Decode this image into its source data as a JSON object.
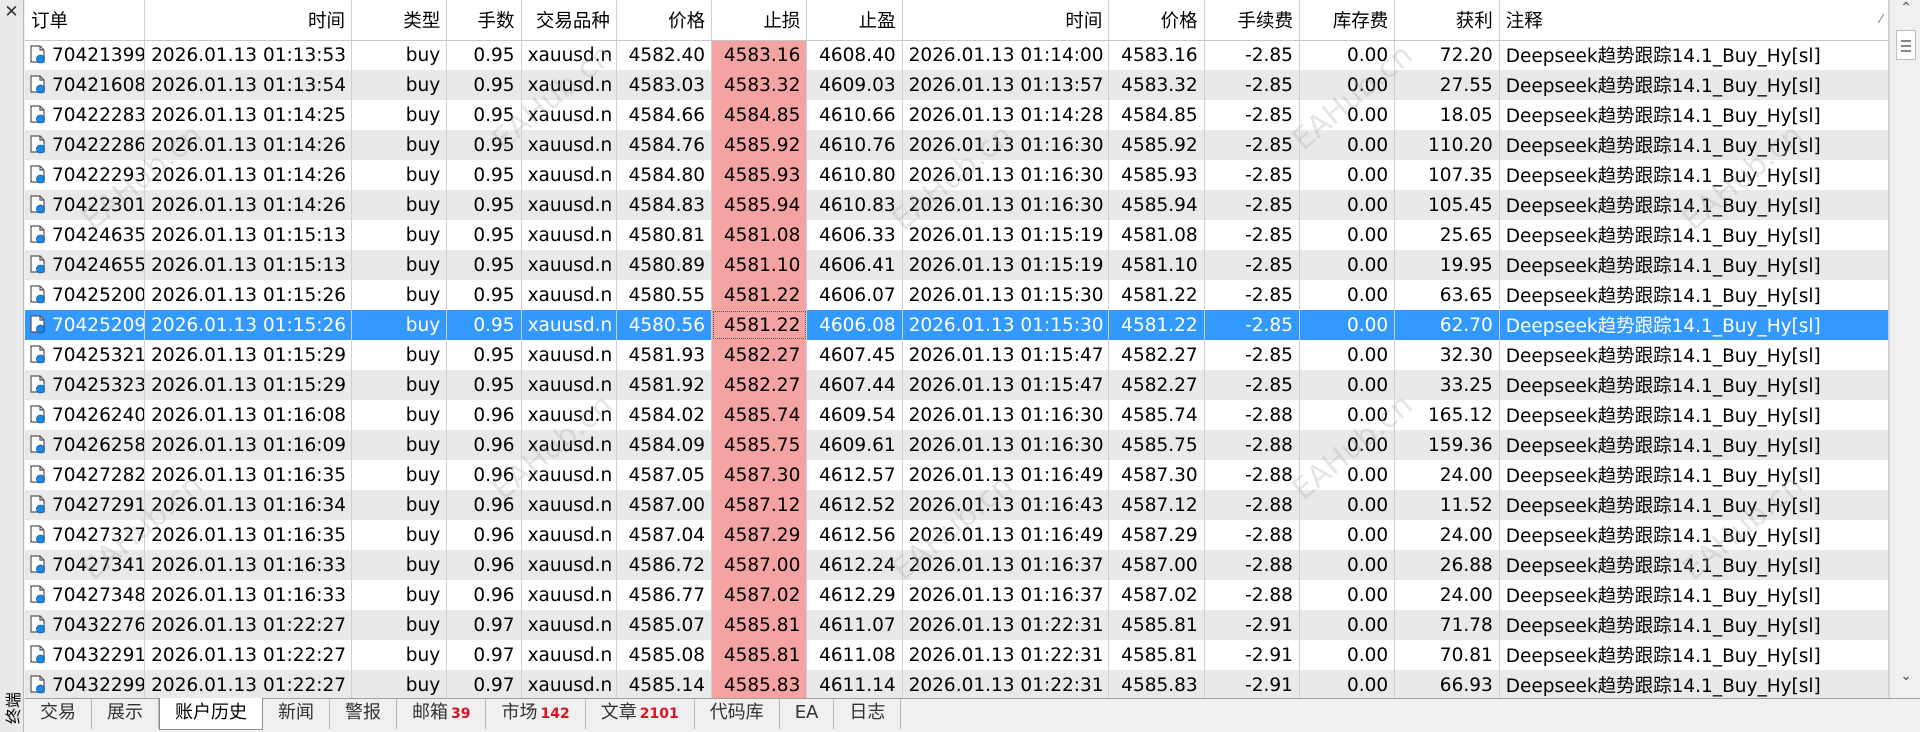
{
  "side_panel": {
    "title": "终端",
    "close_glyph": "✕"
  },
  "columns": [
    "订单",
    "时间",
    "类型",
    "手数",
    "交易品种",
    "价格",
    "止损",
    "止盈",
    "时间",
    "价格",
    "手续费",
    "库存费",
    "获利",
    "注释"
  ],
  "sort_indicator": "⁄",
  "rows": [
    [
      "70421399",
      "2026.01.13 01:13:53",
      "buy",
      "0.95",
      "xauusd.n",
      "4582.40",
      "4583.16",
      "4608.40",
      "2026.01.13 01:14:00",
      "4583.16",
      "-2.85",
      "0.00",
      "72.20",
      "Deepseek趋势跟踪14.1_Buy_Hy[sl]"
    ],
    [
      "70421608",
      "2026.01.13 01:13:54",
      "buy",
      "0.95",
      "xauusd.n",
      "4583.03",
      "4583.32",
      "4609.03",
      "2026.01.13 01:13:57",
      "4583.32",
      "-2.85",
      "0.00",
      "27.55",
      "Deepseek趋势跟踪14.1_Buy_Hy[sl]"
    ],
    [
      "70422283",
      "2026.01.13 01:14:25",
      "buy",
      "0.95",
      "xauusd.n",
      "4584.66",
      "4584.85",
      "4610.66",
      "2026.01.13 01:14:28",
      "4584.85",
      "-2.85",
      "0.00",
      "18.05",
      "Deepseek趋势跟踪14.1_Buy_Hy[sl]"
    ],
    [
      "70422286",
      "2026.01.13 01:14:26",
      "buy",
      "0.95",
      "xauusd.n",
      "4584.76",
      "4585.92",
      "4610.76",
      "2026.01.13 01:16:30",
      "4585.92",
      "-2.85",
      "0.00",
      "110.20",
      "Deepseek趋势跟踪14.1_Buy_Hy[sl]"
    ],
    [
      "70422293",
      "2026.01.13 01:14:26",
      "buy",
      "0.95",
      "xauusd.n",
      "4584.80",
      "4585.93",
      "4610.80",
      "2026.01.13 01:16:30",
      "4585.93",
      "-2.85",
      "0.00",
      "107.35",
      "Deepseek趋势跟踪14.1_Buy_Hy[sl]"
    ],
    [
      "70422301",
      "2026.01.13 01:14:26",
      "buy",
      "0.95",
      "xauusd.n",
      "4584.83",
      "4585.94",
      "4610.83",
      "2026.01.13 01:16:30",
      "4585.94",
      "-2.85",
      "0.00",
      "105.45",
      "Deepseek趋势跟踪14.1_Buy_Hy[sl]"
    ],
    [
      "70424635",
      "2026.01.13 01:15:13",
      "buy",
      "0.95",
      "xauusd.n",
      "4580.81",
      "4581.08",
      "4606.33",
      "2026.01.13 01:15:19",
      "4581.08",
      "-2.85",
      "0.00",
      "25.65",
      "Deepseek趋势跟踪14.1_Buy_Hy[sl]"
    ],
    [
      "70424655",
      "2026.01.13 01:15:13",
      "buy",
      "0.95",
      "xauusd.n",
      "4580.89",
      "4581.10",
      "4606.41",
      "2026.01.13 01:15:19",
      "4581.10",
      "-2.85",
      "0.00",
      "19.95",
      "Deepseek趋势跟踪14.1_Buy_Hy[sl]"
    ],
    [
      "70425200",
      "2026.01.13 01:15:26",
      "buy",
      "0.95",
      "xauusd.n",
      "4580.55",
      "4581.22",
      "4606.07",
      "2026.01.13 01:15:30",
      "4581.22",
      "-2.85",
      "0.00",
      "63.65",
      "Deepseek趋势跟踪14.1_Buy_Hy[sl]"
    ],
    [
      "70425209",
      "2026.01.13 01:15:26",
      "buy",
      "0.95",
      "xauusd.n",
      "4580.56",
      "4581.22",
      "4606.08",
      "2026.01.13 01:15:30",
      "4581.22",
      "-2.85",
      "0.00",
      "62.70",
      "Deepseek趋势跟踪14.1_Buy_Hy[sl]"
    ],
    [
      "70425321",
      "2026.01.13 01:15:29",
      "buy",
      "0.95",
      "xauusd.n",
      "4581.93",
      "4582.27",
      "4607.45",
      "2026.01.13 01:15:47",
      "4582.27",
      "-2.85",
      "0.00",
      "32.30",
      "Deepseek趋势跟踪14.1_Buy_Hy[sl]"
    ],
    [
      "70425323",
      "2026.01.13 01:15:29",
      "buy",
      "0.95",
      "xauusd.n",
      "4581.92",
      "4582.27",
      "4607.44",
      "2026.01.13 01:15:47",
      "4582.27",
      "-2.85",
      "0.00",
      "33.25",
      "Deepseek趋势跟踪14.1_Buy_Hy[sl]"
    ],
    [
      "70426240",
      "2026.01.13 01:16:08",
      "buy",
      "0.96",
      "xauusd.n",
      "4584.02",
      "4585.74",
      "4609.54",
      "2026.01.13 01:16:30",
      "4585.74",
      "-2.88",
      "0.00",
      "165.12",
      "Deepseek趋势跟踪14.1_Buy_Hy[sl]"
    ],
    [
      "70426258",
      "2026.01.13 01:16:09",
      "buy",
      "0.96",
      "xauusd.n",
      "4584.09",
      "4585.75",
      "4609.61",
      "2026.01.13 01:16:30",
      "4585.75",
      "-2.88",
      "0.00",
      "159.36",
      "Deepseek趋势跟踪14.1_Buy_Hy[sl]"
    ],
    [
      "70427282",
      "2026.01.13 01:16:35",
      "buy",
      "0.96",
      "xauusd.n",
      "4587.05",
      "4587.30",
      "4612.57",
      "2026.01.13 01:16:49",
      "4587.30",
      "-2.88",
      "0.00",
      "24.00",
      "Deepseek趋势跟踪14.1_Buy_Hy[sl]"
    ],
    [
      "70427291",
      "2026.01.13 01:16:34",
      "buy",
      "0.96",
      "xauusd.n",
      "4587.00",
      "4587.12",
      "4612.52",
      "2026.01.13 01:16:43",
      "4587.12",
      "-2.88",
      "0.00",
      "11.52",
      "Deepseek趋势跟踪14.1_Buy_Hy[sl]"
    ],
    [
      "70427327",
      "2026.01.13 01:16:35",
      "buy",
      "0.96",
      "xauusd.n",
      "4587.04",
      "4587.29",
      "4612.56",
      "2026.01.13 01:16:49",
      "4587.29",
      "-2.88",
      "0.00",
      "24.00",
      "Deepseek趋势跟踪14.1_Buy_Hy[sl]"
    ],
    [
      "70427341",
      "2026.01.13 01:16:33",
      "buy",
      "0.96",
      "xauusd.n",
      "4586.72",
      "4587.00",
      "4612.24",
      "2026.01.13 01:16:37",
      "4587.00",
      "-2.88",
      "0.00",
      "26.88",
      "Deepseek趋势跟踪14.1_Buy_Hy[sl]"
    ],
    [
      "70427348",
      "2026.01.13 01:16:33",
      "buy",
      "0.96",
      "xauusd.n",
      "4586.77",
      "4587.02",
      "4612.29",
      "2026.01.13 01:16:37",
      "4587.02",
      "-2.88",
      "0.00",
      "24.00",
      "Deepseek趋势跟踪14.1_Buy_Hy[sl]"
    ],
    [
      "70432276",
      "2026.01.13 01:22:27",
      "buy",
      "0.97",
      "xauusd.n",
      "4585.07",
      "4585.81",
      "4611.07",
      "2026.01.13 01:22:31",
      "4585.81",
      "-2.91",
      "0.00",
      "71.78",
      "Deepseek趋势跟踪14.1_Buy_Hy[sl]"
    ],
    [
      "70432291",
      "2026.01.13 01:22:27",
      "buy",
      "0.97",
      "xauusd.n",
      "4585.08",
      "4585.81",
      "4611.08",
      "2026.01.13 01:22:31",
      "4585.81",
      "-2.91",
      "0.00",
      "70.81",
      "Deepseek趋势跟踪14.1_Buy_Hy[sl]"
    ],
    [
      "70432299",
      "2026.01.13 01:22:27",
      "buy",
      "0.97",
      "xauusd.n",
      "4585.14",
      "4585.83",
      "4611.14",
      "2026.01.13 01:22:31",
      "4585.83",
      "-2.91",
      "0.00",
      "66.93",
      "Deepseek趋势跟踪14.1_Buy_Hy[sl]"
    ]
  ],
  "selected_row_index": 9,
  "stoploss_highlight_color": "#f4a3a3",
  "selection_color": "#3399ff",
  "tabs": [
    {
      "label": "交易",
      "badge": ""
    },
    {
      "label": "展示",
      "badge": ""
    },
    {
      "label": "账户历史",
      "badge": "",
      "active": true
    },
    {
      "label": "新闻",
      "badge": ""
    },
    {
      "label": "警报",
      "badge": ""
    },
    {
      "label": "邮箱",
      "badge": "39"
    },
    {
      "label": "市场",
      "badge": "142"
    },
    {
      "label": "文章",
      "badge": "2101"
    },
    {
      "label": "代码库",
      "badge": ""
    },
    {
      "label": "EA",
      "badge": ""
    },
    {
      "label": "日志",
      "badge": ""
    }
  ],
  "watermark_text": "EAHub.cn",
  "icons": {
    "row": "document-icon",
    "scroll_up": "chevron-up-icon",
    "scroll_down": "chevron-down-icon"
  }
}
